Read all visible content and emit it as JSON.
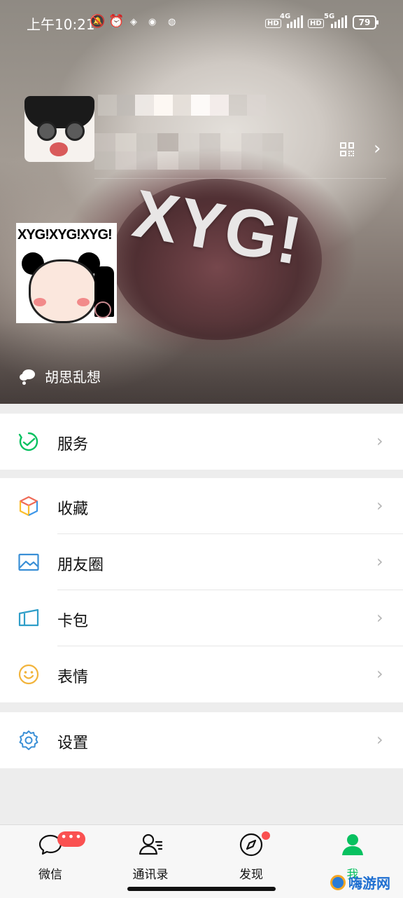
{
  "status_bar": {
    "time": "上午10:21",
    "network_1": "4G",
    "network_2": "5G",
    "hd_label": "HD",
    "battery": "79"
  },
  "profile": {
    "cover_text": "XYG!",
    "sticker_text": "XYG!XYG!XYG!",
    "status_label": "胡思乱想"
  },
  "menu": {
    "services": {
      "label": "服务",
      "icon": "services-icon"
    },
    "favorites": {
      "label": "收藏",
      "icon": "favorites-cube-icon"
    },
    "moments": {
      "label": "朋友圈",
      "icon": "moments-image-icon"
    },
    "cards": {
      "label": "卡包",
      "icon": "card-wallet-icon"
    },
    "stickers": {
      "label": "表情",
      "icon": "smiley-icon"
    },
    "settings": {
      "label": "设置",
      "icon": "gear-icon"
    }
  },
  "tabs": [
    {
      "label": "微信",
      "icon": "chat-bubble-icon",
      "badge": "•••"
    },
    {
      "label": "通讯录",
      "icon": "contacts-icon"
    },
    {
      "label": "发现",
      "icon": "compass-icon"
    },
    {
      "label": "我",
      "icon": "person-icon",
      "active": true
    }
  ],
  "colors": {
    "accent_green": "#07c160",
    "badge_red": "#fa5151"
  },
  "watermark": {
    "text": "嗨游网"
  }
}
